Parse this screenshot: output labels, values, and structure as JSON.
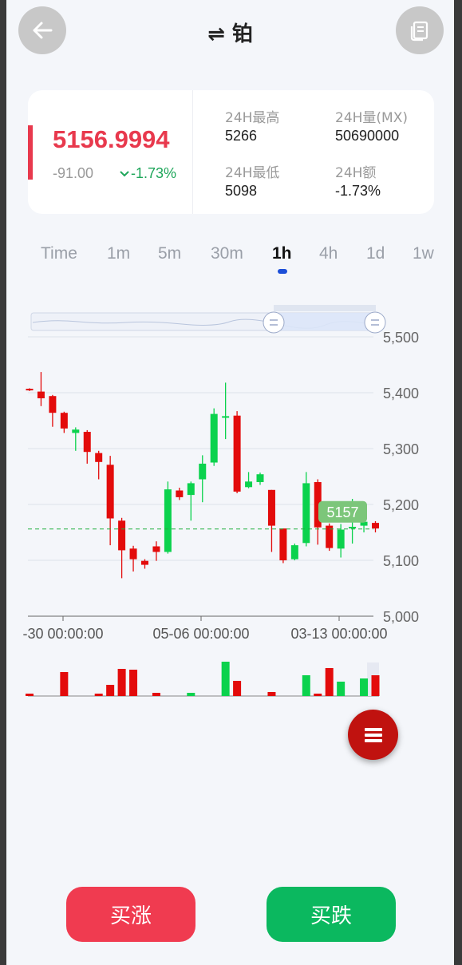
{
  "header": {
    "title": "⇌ 铂",
    "back_icon": "arrow-left-icon",
    "doc_icon": "document-icon"
  },
  "summary": {
    "price": "5156.9994",
    "change_abs": "-91.00",
    "change_pct": "-1.73%",
    "stats": {
      "high_label": "24H最高",
      "high_value": "5266",
      "volume_label": "24H量(MX)",
      "volume_value": "50690000",
      "low_label": "24H最低",
      "low_value": "5098",
      "amount_label": "24H额",
      "amount_value": "-1.73%"
    }
  },
  "tabs": [
    "Time",
    "1m",
    "5m",
    "30m",
    "1h",
    "4h",
    "1d",
    "1w"
  ],
  "active_tab": "1h",
  "chart_data": {
    "type": "candlestick",
    "y_ticks": [
      "5,500",
      "5,400",
      "5,300",
      "5,200",
      "5,100",
      "5,000"
    ],
    "ylim": [
      5000,
      5500
    ],
    "x_ticks": [
      "-30 00:00:00",
      "05-06 00:00:00",
      "03-13 00:00:00"
    ],
    "last_price_label": "5157",
    "last_price": 5156,
    "colors": {
      "up": "#0bd24d",
      "down": "#e30b0b",
      "last_line": "#20b040",
      "last_badge": "#7cc67a"
    },
    "candles": [
      {
        "o": 5407,
        "c": 5405,
        "h": 5408,
        "l": 5403
      },
      {
        "o": 5402,
        "c": 5390,
        "h": 5437,
        "l": 5376
      },
      {
        "o": 5394,
        "c": 5364,
        "h": 5396,
        "l": 5339
      },
      {
        "o": 5364,
        "c": 5336,
        "h": 5366,
        "l": 5328
      },
      {
        "o": 5328,
        "c": 5334,
        "h": 5338,
        "l": 5296
      },
      {
        "o": 5330,
        "c": 5294,
        "h": 5333,
        "l": 5273
      },
      {
        "o": 5292,
        "c": 5276,
        "h": 5296,
        "l": 5245
      },
      {
        "o": 5271,
        "c": 5175,
        "h": 5287,
        "l": 5127
      },
      {
        "o": 5171,
        "c": 5118,
        "h": 5176,
        "l": 5068
      },
      {
        "o": 5121,
        "c": 5102,
        "h": 5126,
        "l": 5080
      },
      {
        "o": 5099,
        "c": 5092,
        "h": 5102,
        "l": 5085
      },
      {
        "o": 5125,
        "c": 5115,
        "h": 5134,
        "l": 5099
      },
      {
        "o": 5115,
        "c": 5227,
        "h": 5241,
        "l": 5112
      },
      {
        "o": 5225,
        "c": 5213,
        "h": 5230,
        "l": 5208
      },
      {
        "o": 5217,
        "c": 5238,
        "h": 5241,
        "l": 5171
      },
      {
        "o": 5245,
        "c": 5273,
        "h": 5288,
        "l": 5204
      },
      {
        "o": 5275,
        "c": 5362,
        "h": 5372,
        "l": 5269
      },
      {
        "o": 5357,
        "c": 5358,
        "h": 5418,
        "l": 5317
      },
      {
        "o": 5359,
        "c": 5223,
        "h": 5367,
        "l": 5220
      },
      {
        "o": 5231,
        "c": 5241,
        "h": 5258,
        "l": 5229
      },
      {
        "o": 5240,
        "c": 5254,
        "h": 5257,
        "l": 5235
      },
      {
        "o": 5226,
        "c": 5162,
        "h": 5226,
        "l": 5115
      },
      {
        "o": 5157,
        "c": 5100,
        "h": 5157,
        "l": 5095
      },
      {
        "o": 5102,
        "c": 5127,
        "h": 5130,
        "l": 5100
      },
      {
        "o": 5131,
        "c": 5238,
        "h": 5258,
        "l": 5125
      },
      {
        "o": 5240,
        "c": 5159,
        "h": 5245,
        "l": 5128
      },
      {
        "o": 5162,
        "c": 5122,
        "h": 5166,
        "l": 5117
      },
      {
        "o": 5121,
        "c": 5155,
        "h": 5165,
        "l": 5105
      },
      {
        "o": 5157,
        "c": 5160,
        "h": 5210,
        "l": 5130
      },
      {
        "o": 5162,
        "c": 5169,
        "h": 5178,
        "l": 5150
      },
      {
        "o": 5167,
        "c": 5157,
        "h": 5170,
        "l": 5150
      }
    ]
  },
  "buttons": {
    "buy_up": "买涨",
    "buy_down": "买跌"
  }
}
